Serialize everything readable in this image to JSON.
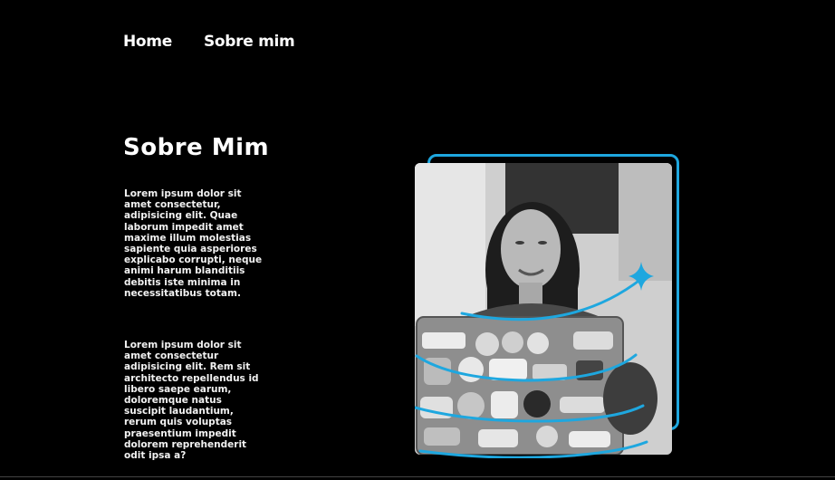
{
  "nav": {
    "items": [
      {
        "label": "Home"
      },
      {
        "label": "Sobre mim"
      }
    ]
  },
  "about": {
    "title": "Sobre Mim",
    "paragraph1": "Lorem ipsum dolor sit amet consectetur, adipisicing elit. Quae laborum impedit amet maxime illum molestias sapiente quia asperiores explicabo corrupti, neque animi harum blanditiis debitis iste minima in necessitatibus totam.",
    "paragraph2": "Lorem ipsum dolor sit amet consectetur adipisicing elit. Rem sit architecto repellendus id libero saepe earum, doloremque natus suscipit laudantium, rerum quis voluptas praesentium impedit dolorem reprehenderit odit ipsa a?"
  },
  "colors": {
    "background": "#000000",
    "accent": "#1ea7df",
    "text": "#ffffff"
  },
  "icons": {
    "sparkle": "sparkle-icon"
  }
}
